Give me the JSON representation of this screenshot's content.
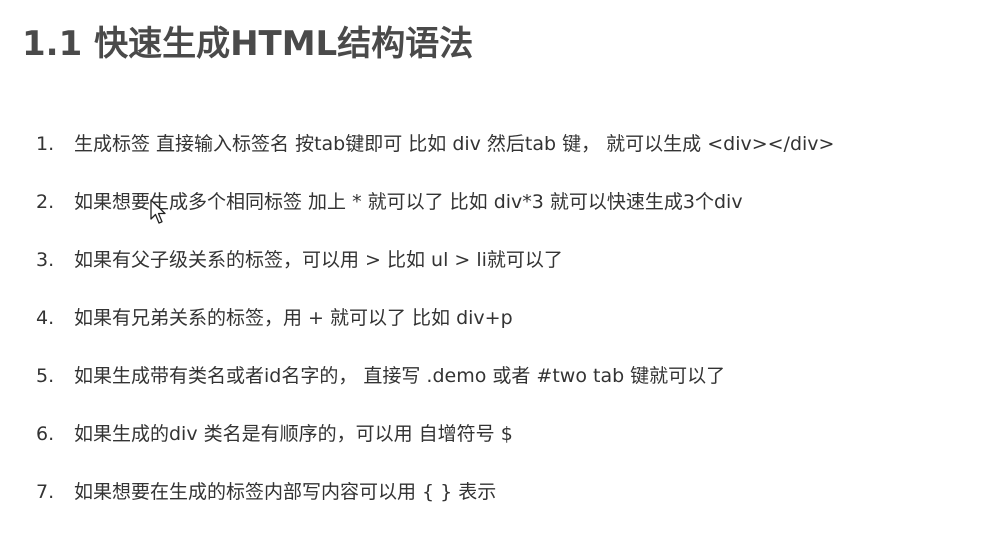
{
  "title": "1.1 快速生成HTML结构语法",
  "items": [
    {
      "num": "1.",
      "text": "生成标签 直接输入标签名 按tab键即可  比如  div   然后tab 键， 就可以生成 <div></div>"
    },
    {
      "num": "2.",
      "text": "如果想要生成多个相同标签  加上 * 就可以了 比如   div*3  就可以快速生成3个div"
    },
    {
      "num": "3.",
      "text": "如果有父子级关系的标签，可以用 >  比如   ul > li就可以了"
    },
    {
      "num": "4.",
      "text": "如果有兄弟关系的标签，用  +  就可以了 比如 div+p"
    },
    {
      "num": "5.",
      "text": "如果生成带有类名或者id名字的，  直接写  .demo  或者  #two   tab 键就可以了"
    },
    {
      "num": "6.",
      "text": "如果生成的div 类名是有顺序的，可以用 自增符号  $"
    },
    {
      "num": "7.",
      "text": "如果想要在生成的标签内部写内容可以用  { }  表示"
    }
  ],
  "icons": {
    "cursor": "mouse-pointer-icon"
  }
}
